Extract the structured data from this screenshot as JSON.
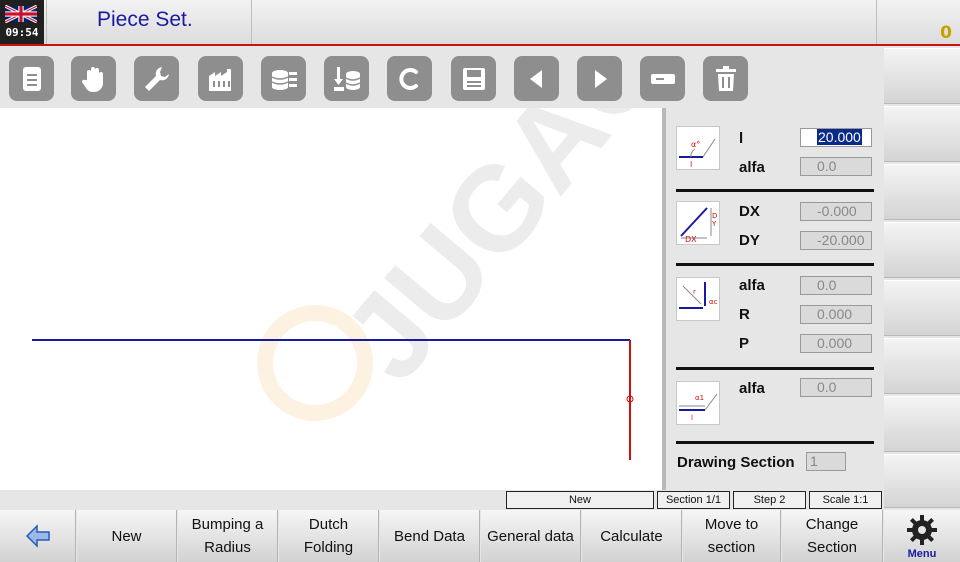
{
  "header": {
    "clock": "09:54",
    "title": "Piece Set.",
    "counter": "0"
  },
  "toolbar": {
    "icons": [
      "document-icon",
      "hand-icon",
      "wrench-icon",
      "factory-icon",
      "database-icon",
      "database-import-icon",
      "clear-icon",
      "save-icon",
      "arrow-left-icon",
      "arrow-right-icon",
      "minus-icon",
      "trash-icon"
    ]
  },
  "panel": {
    "line_section": {
      "l_label": "l",
      "l_value": "20.000",
      "alfa_label": "alfa",
      "alfa_value": "0.0"
    },
    "delta_section": {
      "dx_label": "DX",
      "dx_value": "-0.000",
      "dy_label": "DY",
      "dy_value": "-20.000"
    },
    "radius_section": {
      "alfa_label": "alfa",
      "alfa_value": "0.0",
      "r_label": "R",
      "r_value": "0.000",
      "p_label": "P",
      "p_value": "0.000"
    },
    "angle_section": {
      "alfa_label": "alfa",
      "alfa_value": "0.0"
    },
    "drawing_section": {
      "label": "Drawing Section",
      "value": "1"
    }
  },
  "status": {
    "mode": "New",
    "section": "Section 1/1",
    "step": "Step 2",
    "scale": "Scale 1:1"
  },
  "softkeys": {
    "new": "New",
    "bumping_1": "Bumping a",
    "bumping_2": "Radius",
    "dutch_1": "Dutch",
    "dutch_2": "Folding",
    "bend_data": "Bend Data",
    "general_data": "General data",
    "calculate": "Calculate",
    "move_1": "Move to",
    "move_2": "section",
    "change_1": "Change",
    "change_2": "Section",
    "menu": "Menu"
  },
  "watermark": "JUGAO",
  "colors": {
    "title": "#1a1aa0",
    "accent_red": "#d01010",
    "profile_blue": "#1a1aa0",
    "profile_red": "#d01010",
    "selection": "#0a2a8a"
  }
}
